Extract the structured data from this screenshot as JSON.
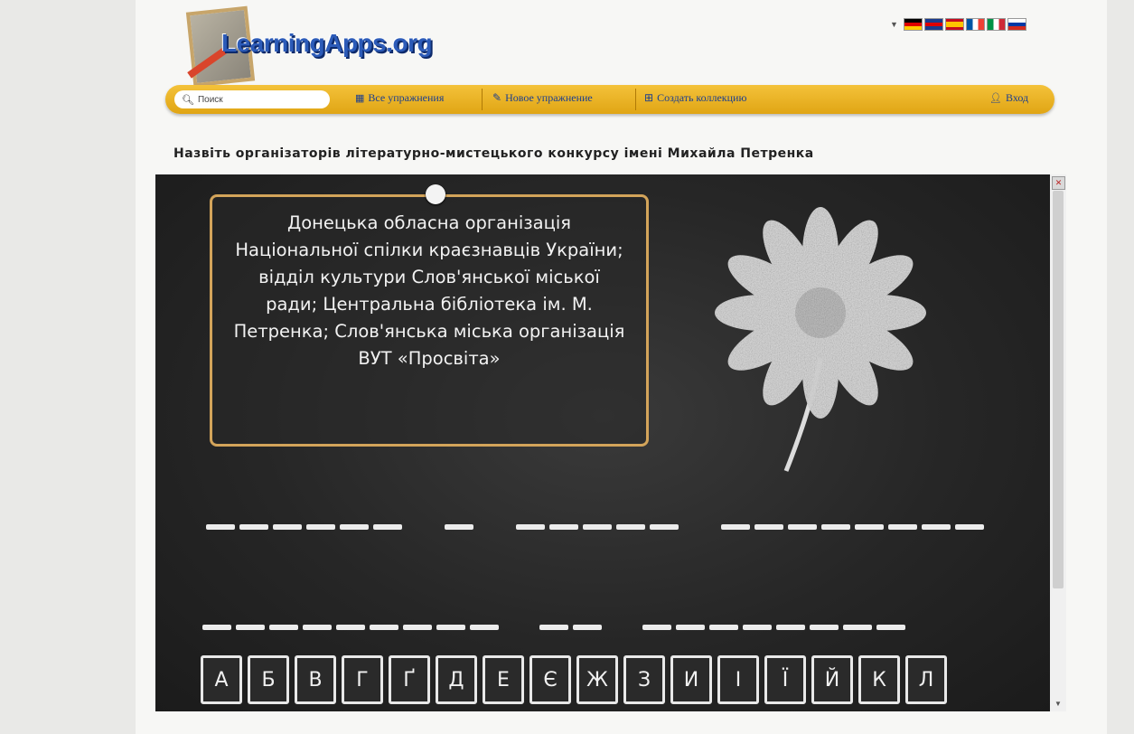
{
  "header": {
    "logo_text": "LearningApps.org",
    "languages": [
      "de",
      "gb",
      "es",
      "fr",
      "it",
      "ru"
    ]
  },
  "navbar": {
    "search_placeholder": "Поиск",
    "all_exercises": "Все упражнения",
    "new_exercise": "Новое упражнение",
    "create_collection": "Создать коллекцию",
    "login": "Вход"
  },
  "exercise": {
    "title": "Назвіть організаторів літературно-мистецького конкурсу імені Михайла Петренка",
    "clue": "Донецька обласна організація Національної спілки краєзнавців України; відділ культури Слов'янської міської ради; Центральна бібліотека ім. М. Петренка; Слов'янська міська організація ВУТ «Просвіта»",
    "word_lengths_row1": [
      6,
      1,
      5,
      8
    ],
    "word_lengths_row2": [
      9,
      2,
      8
    ],
    "letters": [
      "А",
      "Б",
      "В",
      "Г",
      "Ґ",
      "Д",
      "Е",
      "Є",
      "Ж",
      "З",
      "И",
      "І",
      "Ї",
      "Й",
      "К",
      "Л"
    ]
  },
  "colors": {
    "navbar": "#e8b01f",
    "nav_link": "#1c3f8f",
    "board": "#262626",
    "card_border": "#d3a45a",
    "chalk": "#ececec"
  }
}
